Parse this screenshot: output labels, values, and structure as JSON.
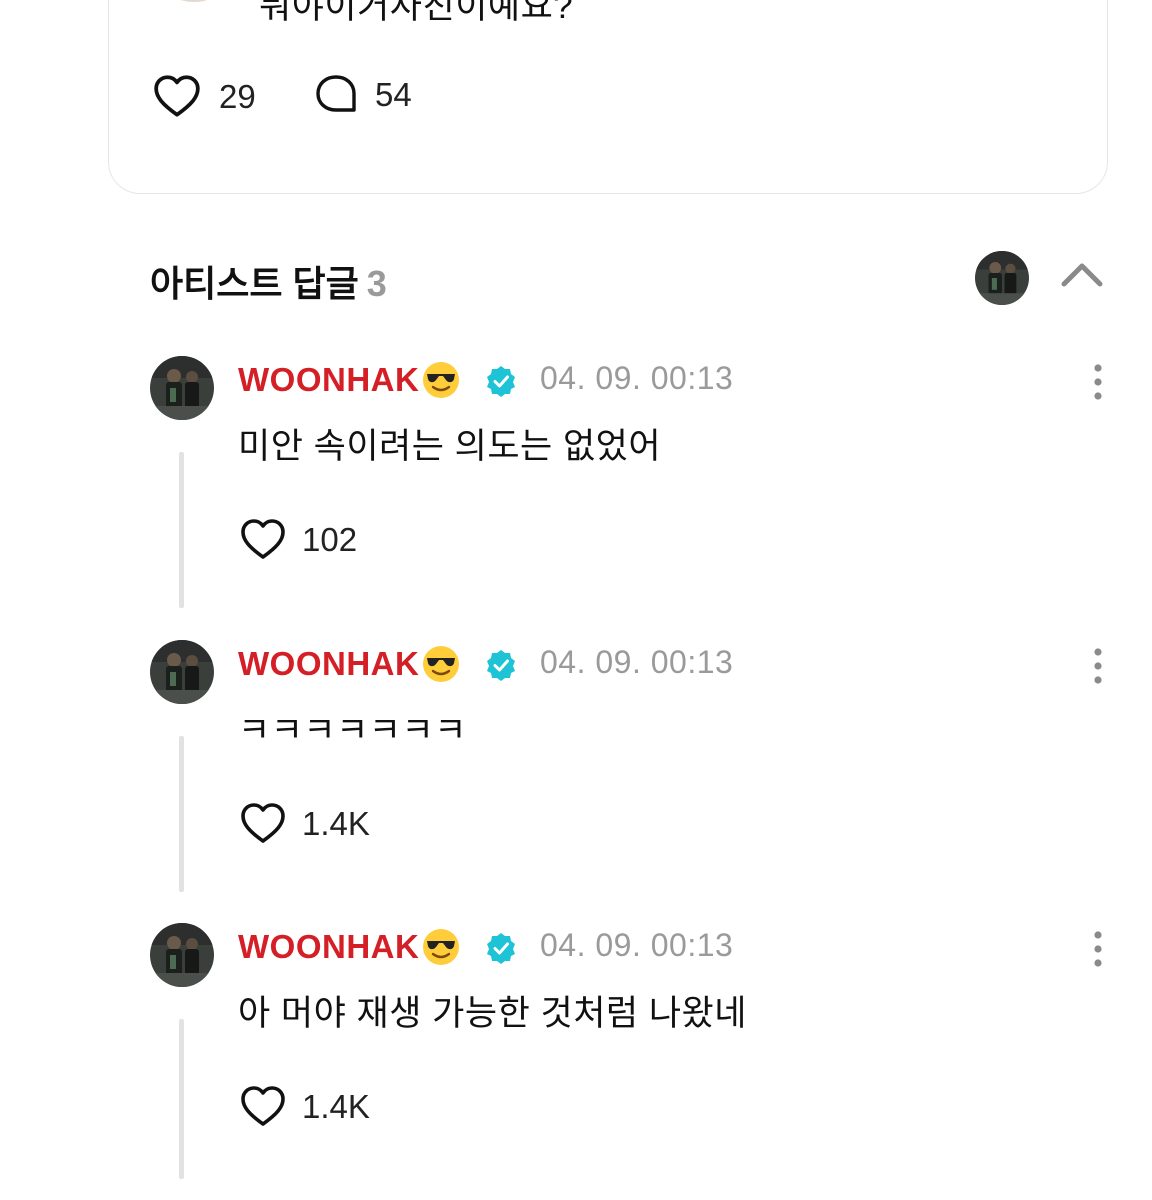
{
  "post": {
    "text": "뭐야이거사진이예요?",
    "likes": "29",
    "comments": "54"
  },
  "section": {
    "title": "아티스트 답글",
    "count": "3"
  },
  "replies": [
    {
      "name": "WOONHAK",
      "emoji": "sunglasses-emoji",
      "time": "04. 09. 00:13",
      "text": "미안 속이려는 의도는 없었어",
      "likes": "102"
    },
    {
      "name": "WOONHAK",
      "emoji": "sunglasses-emoji",
      "time": "04. 09. 00:13",
      "text": "ㅋㅋㅋㅋㅋㅋㅋ",
      "likes": "1.4K"
    },
    {
      "name": "WOONHAK",
      "emoji": "sunglasses-emoji",
      "time": "04. 09. 00:13",
      "text": "아 머야 재생 가능한 것처럼 나왔네",
      "likes": "1.4K"
    }
  ],
  "colors": {
    "artist_name": "#d41f26",
    "verified": "#1fc3d6",
    "muted": "#9a9a9a"
  },
  "icons": [
    "heart-icon",
    "comment-bubble-icon",
    "chevron-up-icon",
    "verified-badge-icon",
    "more-vertical-icon"
  ]
}
